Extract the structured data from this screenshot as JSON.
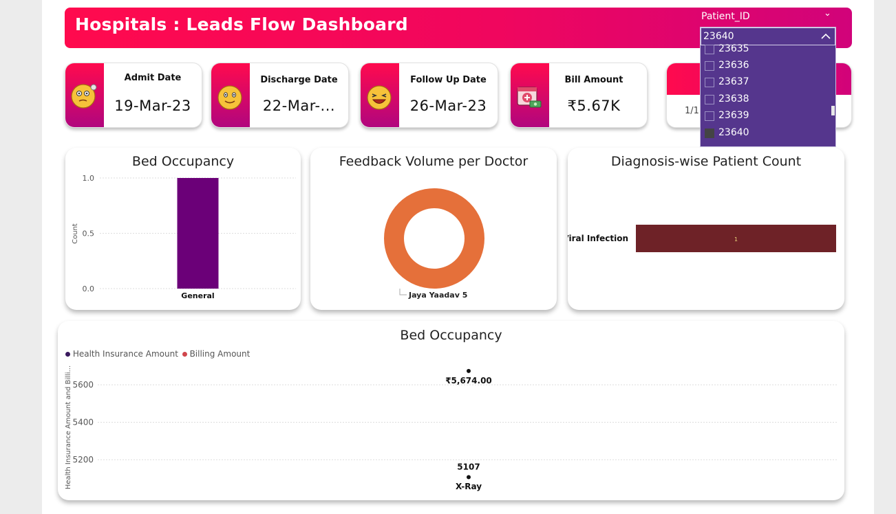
{
  "header": {
    "title": "Hospitals : Leads Flow Dashboard"
  },
  "slicer": {
    "label": "Patient_ID",
    "selected": "23640",
    "options": [
      {
        "id": "23635",
        "checked": false
      },
      {
        "id": "23636",
        "checked": false
      },
      {
        "id": "23637",
        "checked": false
      },
      {
        "id": "23638",
        "checked": false
      },
      {
        "id": "23639",
        "checked": false
      },
      {
        "id": "23640",
        "checked": true
      }
    ]
  },
  "cards": [
    {
      "label": "Admit Date",
      "value": "19-Mar-23",
      "icon": "thinking-face-icon"
    },
    {
      "label": "Discharge Date",
      "value": "22-Mar-...",
      "icon": "smiling-face-icon"
    },
    {
      "label": "Follow Up Date",
      "value": "26-Mar-23",
      "icon": "laughing-face-icon"
    },
    {
      "label": "Bill Amount",
      "value": "₹5.67K",
      "icon": "medical-bill-icon"
    }
  ],
  "partial_card": {
    "value": "1/1"
  },
  "bed_chart": {
    "title": "Bed Occupancy",
    "chart_data": {
      "type": "bar",
      "categories": [
        "General"
      ],
      "values": [
        1.0
      ],
      "ylabel": "Count",
      "yticks": [
        "1.0",
        "0.5",
        "0.0"
      ],
      "ylim": [
        0,
        1
      ],
      "color": "#6b0078"
    }
  },
  "feedback_chart": {
    "title": "Feedback Volume per Doctor",
    "chart_data": {
      "type": "pie",
      "labels": [
        "Jaya Yaadav 5"
      ],
      "values": [
        1
      ],
      "color": "#e5703a"
    }
  },
  "diagnosis_chart": {
    "title": "Diagnosis-wise Patient Count",
    "chart_data": {
      "type": "bar",
      "orientation": "horizontal",
      "categories": [
        "Viral Infection"
      ],
      "values": [
        1
      ],
      "data_labels": [
        "1"
      ],
      "color": "#6e2227"
    }
  },
  "billing_chart": {
    "title": "Bed Occupancy",
    "legend": [
      {
        "name": "Health Insurance Amount",
        "color": "#3a1a5e"
      },
      {
        "name": "Billing Amount",
        "color": "#d0464c"
      }
    ],
    "ylabel": "Health Insurance Amount and Billi...",
    "yticks": [
      "5600",
      "5400",
      "5200"
    ],
    "chart_data": {
      "type": "scatter",
      "categories": [
        "X-Ray"
      ],
      "series": [
        {
          "name": "Health Insurance Amount",
          "values": [
            5107
          ],
          "label": "5107"
        },
        {
          "name": "Billing Amount",
          "values": [
            5674
          ],
          "label": "₹5,674.00"
        }
      ],
      "ylim": [
        5100,
        5730
      ]
    }
  }
}
